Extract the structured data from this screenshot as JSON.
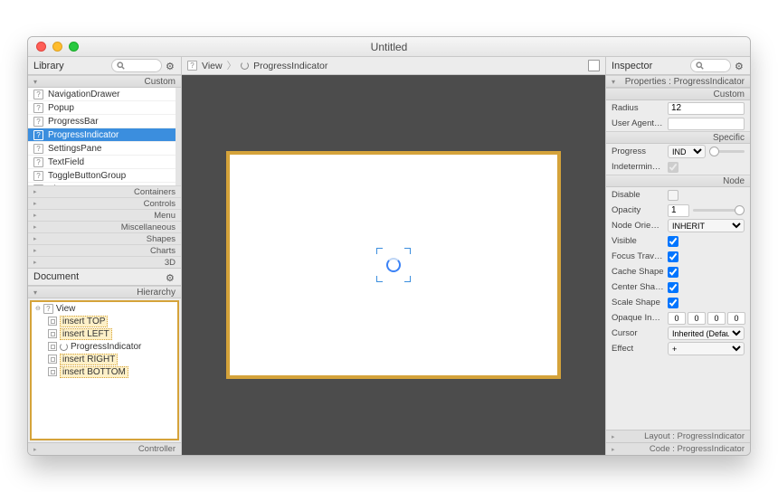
{
  "window": {
    "title": "Untitled"
  },
  "library": {
    "title": "Library",
    "sections": {
      "custom": "Custom",
      "containers": "Containers",
      "controls": "Controls",
      "menu": "Menu",
      "miscellaneous": "Miscellaneous",
      "shapes": "Shapes",
      "charts": "Charts",
      "threeD": "3D"
    },
    "items": [
      "NavigationDrawer",
      "Popup",
      "ProgressBar",
      "ProgressIndicator",
      "SettingsPane",
      "TextField",
      "ToggleButtonGroup",
      "View"
    ],
    "selectedIndex": 3
  },
  "document": {
    "title": "Document",
    "hierarchy_label": "Hierarchy",
    "controller_label": "Controller",
    "tree": {
      "root": "View",
      "items": [
        "insert TOP",
        "insert LEFT",
        "ProgressIndicator",
        "insert RIGHT",
        "insert BOTTOM"
      ]
    }
  },
  "breadcrumb": {
    "view": "View",
    "item": "ProgressIndicator"
  },
  "inspector": {
    "title": "Inspector",
    "properties_label": "Properties : ProgressIndicator",
    "groups": {
      "custom": "Custom",
      "specific": "Specific",
      "node": "Node"
    },
    "custom": {
      "radius_label": "Radius",
      "radius_value": "12",
      "uas_label": "User Agent S...",
      "uas_value": ""
    },
    "specific": {
      "progress_label": "Progress",
      "progress_mode": "IND",
      "indeterminate_label": "Indeterminate",
      "indeterminate": true
    },
    "node": {
      "disable_label": "Disable",
      "disable": false,
      "opacity_label": "Opacity",
      "opacity_value": "1",
      "orientation_label": "Node Orienta...",
      "orientation_value": "INHERIT",
      "visible_label": "Visible",
      "visible": true,
      "focus_label": "Focus Traver...",
      "focus": true,
      "cache_label": "Cache Shape",
      "cache": true,
      "center_label": "Center Shape",
      "center": true,
      "scale_label": "Scale Shape",
      "scale": true,
      "insets_label": "Opaque Insets",
      "insets": [
        "0",
        "0",
        "0",
        "0"
      ],
      "cursor_label": "Cursor",
      "cursor_value": "Inherited (Default)",
      "effect_label": "Effect",
      "effect_value": "+"
    },
    "footer": {
      "layout": "Layout : ProgressIndicator",
      "code": "Code : ProgressIndicator"
    }
  }
}
